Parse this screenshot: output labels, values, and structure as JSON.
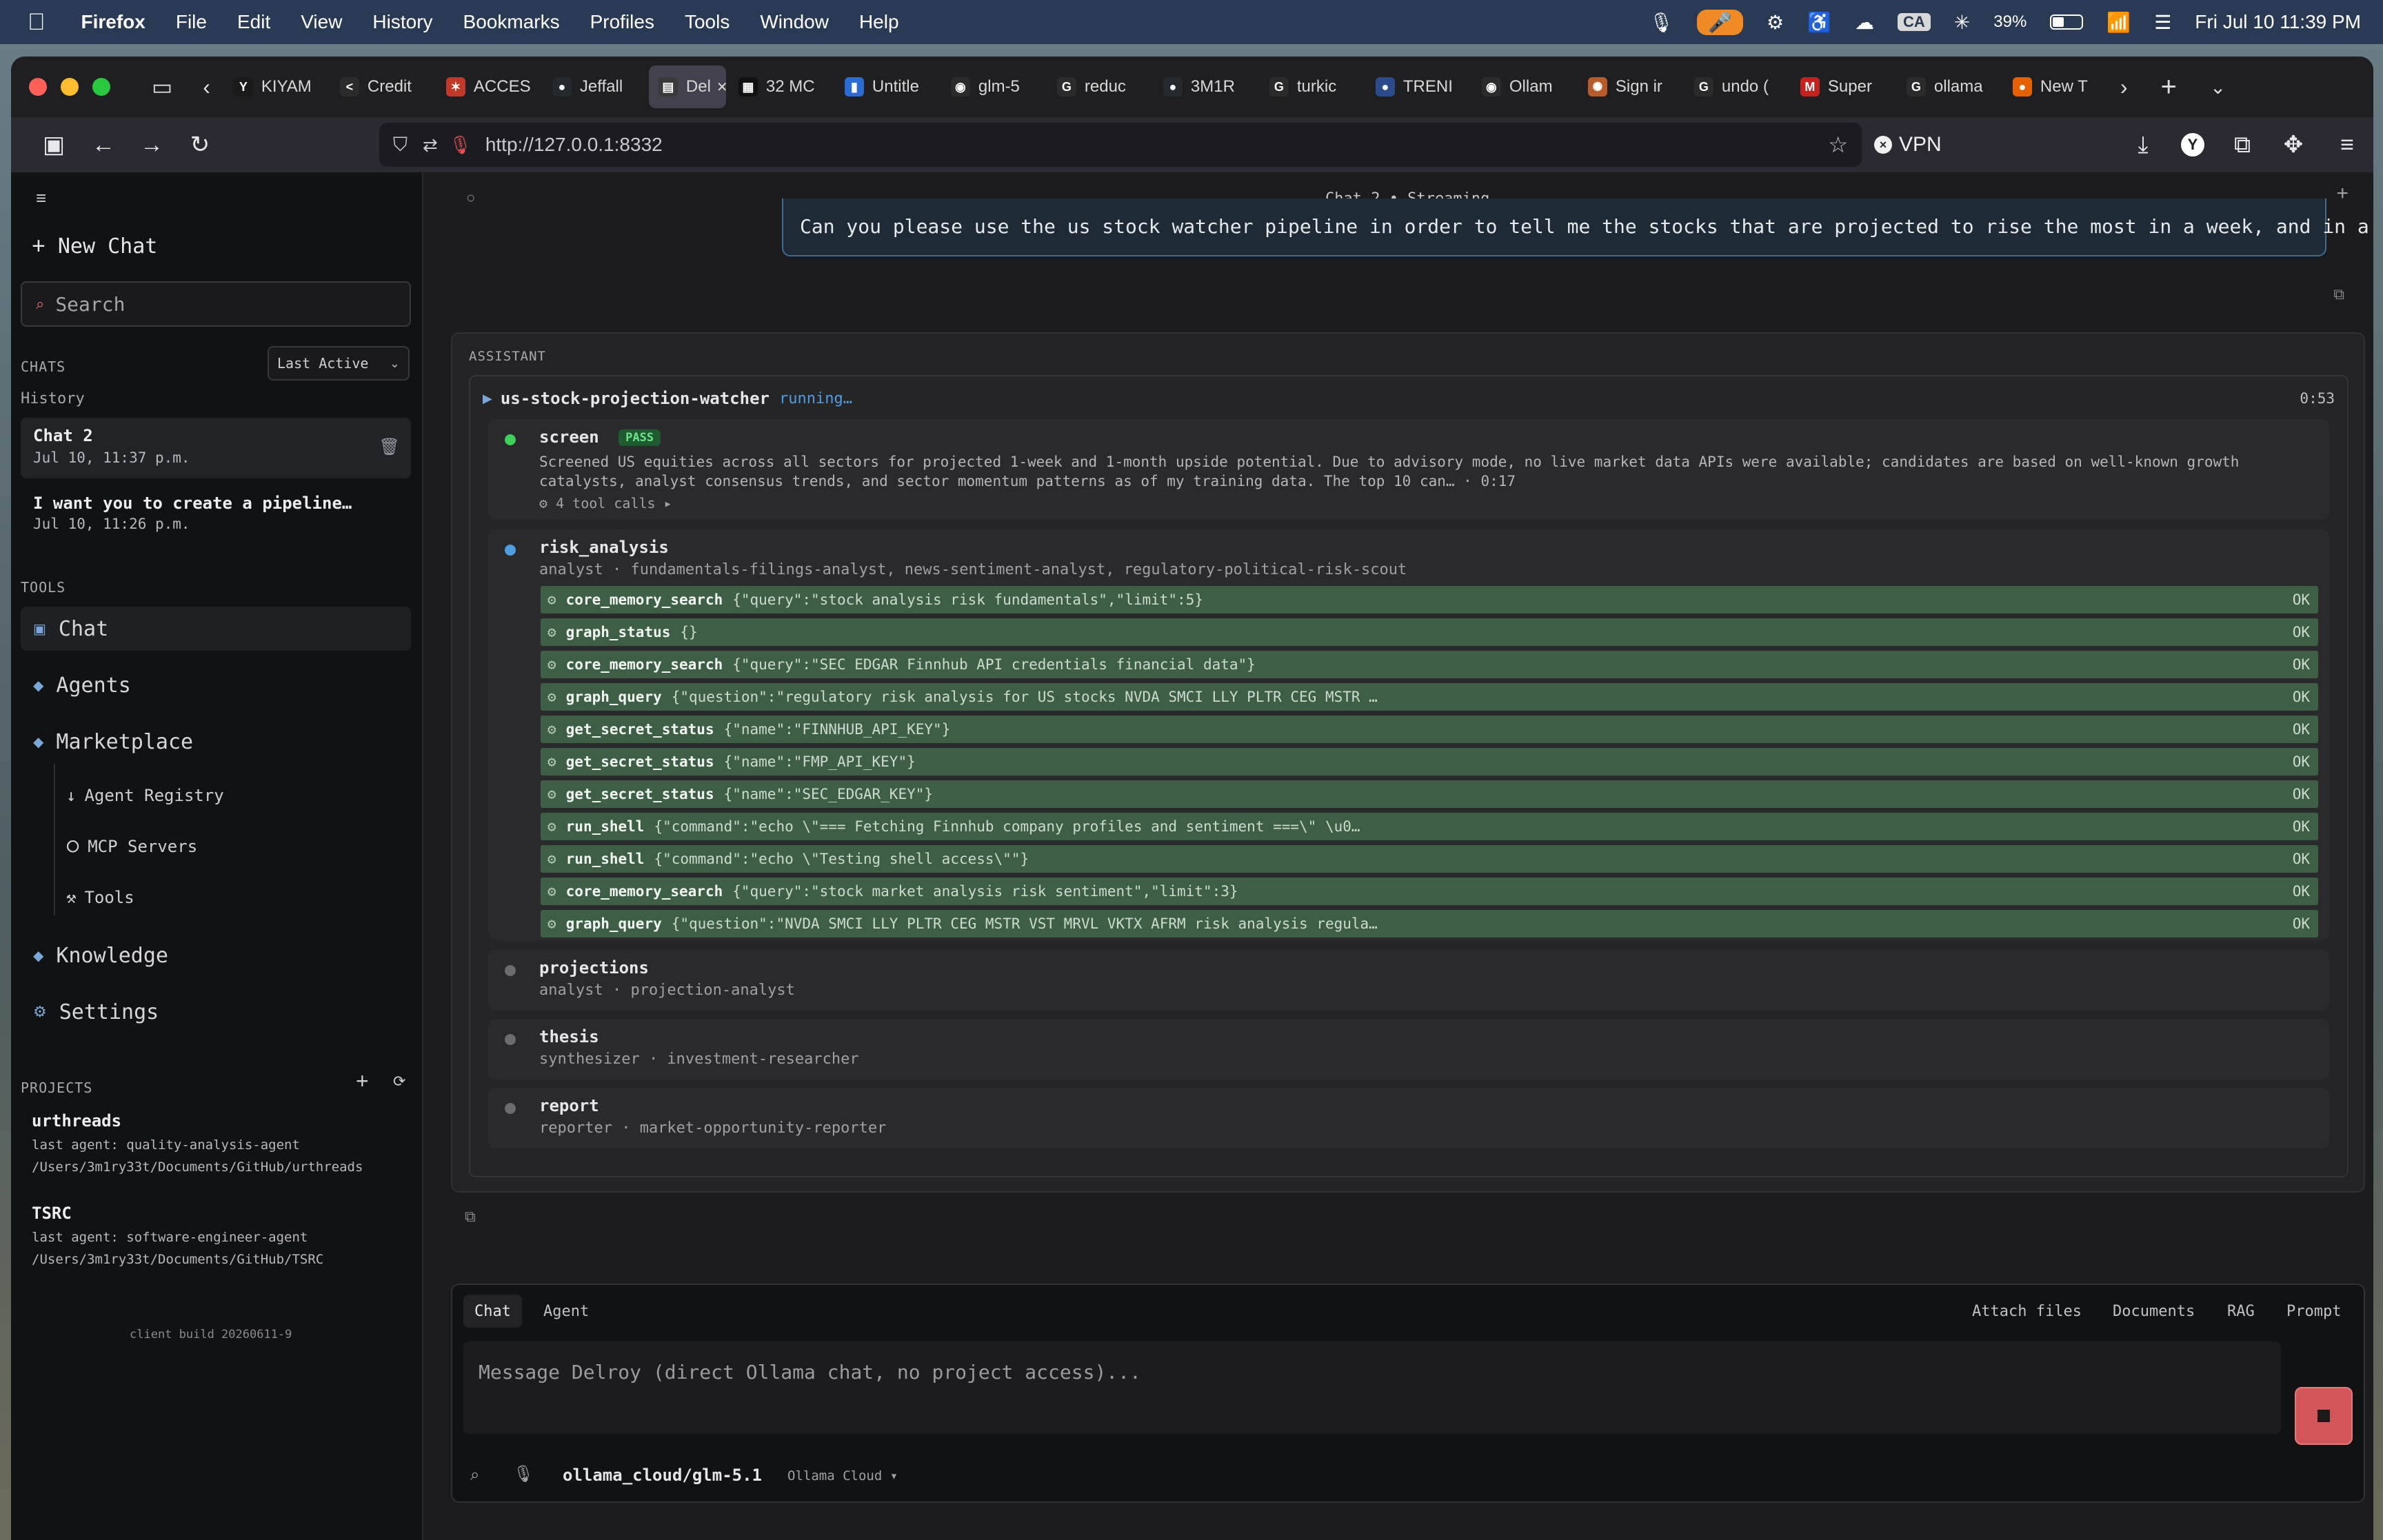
{
  "menubar": {
    "app_name": "Firefox",
    "menus": [
      "File",
      "Edit",
      "View",
      "History",
      "Bookmarks",
      "Profiles",
      "Tools",
      "Window",
      "Help"
    ],
    "battery": "39%",
    "clock": "Fri Jul 10  11:39 PM",
    "ca_badge": "CA"
  },
  "tabs": [
    {
      "label": "KIYAM",
      "fav": "Y",
      "color": "#1a1a1a"
    },
    {
      "label": "Credit",
      "fav": "<",
      "color": "#2b2b2b"
    },
    {
      "label": "ACCES",
      "fav": "✶",
      "color": "#c0392b"
    },
    {
      "label": "Jeffall",
      "fav": "●",
      "color": "#24292e"
    },
    {
      "label": "Del",
      "fav": "▤",
      "color": "#3a3a3a",
      "active": true
    },
    {
      "label": "32 MC",
      "fav": "▦",
      "color": "#111"
    },
    {
      "label": "Untitle",
      "fav": "▮",
      "color": "#2a6bd6"
    },
    {
      "label": "glm-5",
      "fav": "◉",
      "color": "#2b2b2b"
    },
    {
      "label": "reduc",
      "fav": "G",
      "color": "#2b2b2b"
    },
    {
      "label": "3M1R",
      "fav": "●",
      "color": "#24292e"
    },
    {
      "label": "turkic",
      "fav": "G",
      "color": "#2b2b2b"
    },
    {
      "label": "TRENI",
      "fav": "●",
      "color": "#2b4b8a"
    },
    {
      "label": "Ollam",
      "fav": "◉",
      "color": "#2b2b2b"
    },
    {
      "label": "Sign ir",
      "fav": "✺",
      "color": "#b85a2a"
    },
    {
      "label": "undo (",
      "fav": "G",
      "color": "#2b2b2b"
    },
    {
      "label": "Super",
      "fav": "M",
      "color": "#c5221f"
    },
    {
      "label": "ollama",
      "fav": "G",
      "color": "#2b2b2b"
    },
    {
      "label": "New T",
      "fav": "●",
      "color": "#e66000"
    }
  ],
  "nav": {
    "url": "http://127.0.0.1:8332",
    "vpn": "VPN"
  },
  "sidebar": {
    "new_chat": "New Chat",
    "search_placeholder": "Search",
    "chats_label": "CHATS",
    "sort": "Last Active",
    "history_label": "History",
    "chat_items": [
      {
        "title": "Chat 2",
        "date": "Jul 10, 11:37 p.m."
      },
      {
        "title": "I want you to create a pipeline…",
        "date": "Jul 10, 11:26 p.m."
      }
    ],
    "tools_label": "TOOLS",
    "tools": [
      "Chat",
      "Agents",
      "Marketplace"
    ],
    "market_sub": [
      "Agent Registry",
      "MCP Servers",
      "Tools"
    ],
    "tools_after": [
      "Knowledge",
      "Settings"
    ],
    "projects_label": "PROJECTS",
    "projects": [
      {
        "name": "urthreads",
        "agent": "last agent: quality-analysis-agent",
        "path": "/Users/3m1ry33t/Documents/GitHub/urthreads"
      },
      {
        "name": "TSRC",
        "agent": "last agent: software-engineer-agent",
        "path": "/Users/3m1ry33t/Documents/GitHub/TSRC"
      }
    ],
    "build": "client build 20260611-9"
  },
  "main": {
    "header": "Chat 2 • Streaming",
    "user_message": "Can you please use the us stock watcher pipeline in order to tell me the stocks that are projected to rise the most in a week, and in a month?",
    "assistant_label": "ASSISTANT",
    "pipeline_name": "us-stock-projection-watcher",
    "pipeline_status": "running…",
    "pipeline_time": "0:53",
    "screen": {
      "title": "screen",
      "badge": "PASS",
      "text1": "Screened US equities across all sectors for projected 1-week and 1-month upside potential. Due to advisory mode, no live market data APIs were available; candidates are based on well-known growth",
      "text2": "catalysts, analyst consensus trends, and sector momentum patterns as of my training data. The top 10 can… · 0:17",
      "tool_calls": "⚙ 4 tool calls ▸"
    },
    "risk": {
      "title": "risk_analysis",
      "sub": "analyst · fundamentals-filings-analyst, news-sentiment-analyst, regulatory-political-risk-scout",
      "rows": [
        {
          "name": "core_memory_search",
          "args": "{\"query\":\"stock analysis risk fundamentals\",\"limit\":5}",
          "status": "OK"
        },
        {
          "name": "graph_status",
          "args": "{}",
          "status": "OK"
        },
        {
          "name": "core_memory_search",
          "args": "{\"query\":\"SEC EDGAR Finnhub API credentials financial data\"}",
          "status": "OK"
        },
        {
          "name": "graph_query",
          "args": "{\"question\":\"regulatory risk analysis for US stocks NVDA SMCI LLY PLTR CEG MSTR …",
          "status": "OK"
        },
        {
          "name": "get_secret_status",
          "args": "{\"name\":\"FINNHUB_API_KEY\"}",
          "status": "OK"
        },
        {
          "name": "get_secret_status",
          "args": "{\"name\":\"FMP_API_KEY\"}",
          "status": "OK"
        },
        {
          "name": "get_secret_status",
          "args": "{\"name\":\"SEC_EDGAR_KEY\"}",
          "status": "OK"
        },
        {
          "name": "run_shell",
          "args": "{\"command\":\"echo \\\"=== Fetching Finnhub company profiles and sentiment ===\\\" \\u0…",
          "status": "OK"
        },
        {
          "name": "run_shell",
          "args": "{\"command\":\"echo \\\"Testing shell access\\\"\"}",
          "status": "OK"
        },
        {
          "name": "core_memory_search",
          "args": "{\"query\":\"stock market analysis risk sentiment\",\"limit\":3}",
          "status": "OK"
        },
        {
          "name": "graph_query",
          "args": "{\"question\":\"NVDA SMCI LLY PLTR CEG MSTR VST MRVL VKTX AFRM risk analysis regula…",
          "status": "OK"
        }
      ]
    },
    "projections": {
      "title": "projections",
      "sub": "analyst · projection-analyst"
    },
    "thesis": {
      "title": "thesis",
      "sub": "synthesizer · investment-researcher"
    },
    "report": {
      "title": "report",
      "sub": "reporter · market-opportunity-reporter"
    },
    "composer": {
      "tab_chat": "Chat",
      "tab_agent": "Agent",
      "attach": "Attach files",
      "documents": "Documents",
      "rag": "RAG",
      "prompt": "Prompt",
      "placeholder": "Message Delroy (direct Ollama chat, no project access)...",
      "model": "ollama_cloud/glm-5.1",
      "provider": "Ollama Cloud ▾"
    }
  }
}
